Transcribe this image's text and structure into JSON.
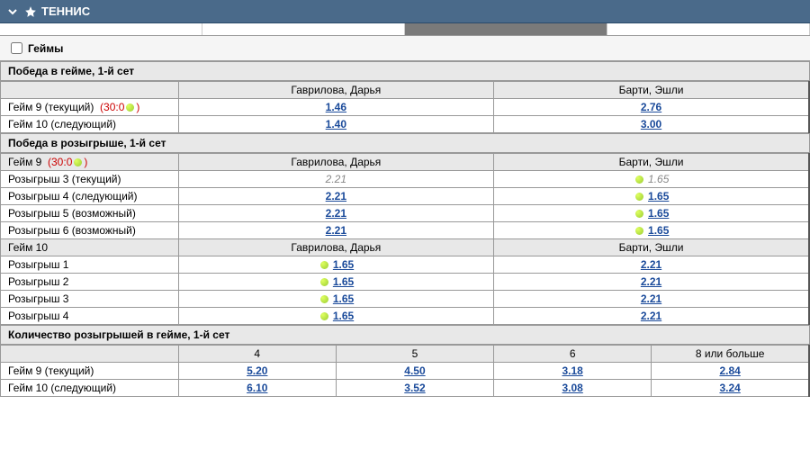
{
  "header": {
    "title": "ТЕННИС"
  },
  "category": {
    "label": "Геймы"
  },
  "market1": {
    "title": "Победа в гейме, 1-й сет",
    "players": [
      "Гаврилова, Дарья",
      "Барти, Эшли"
    ],
    "rows": [
      {
        "label": "Гейм 9  (текущий)",
        "score": "(30:0",
        "ball": true,
        "score_end": ")",
        "odds": [
          "1.46",
          "2.76"
        ]
      },
      {
        "label": "Гейм 10  (следующий)",
        "odds": [
          "1.40",
          "3.00"
        ]
      }
    ]
  },
  "market2": {
    "title": "Победа в розыгрыше, 1-й сет",
    "groups": [
      {
        "header_label": "Гейм 9",
        "header_score": "(30:0",
        "header_ball": true,
        "header_score_end": ")",
        "players": [
          "Гаврилова, Дарья",
          "Барти, Эшли"
        ],
        "rows": [
          {
            "label": "Розыгрыш 3  (текущий)",
            "odds": [
              {
                "v": "2.21",
                "locked": true,
                "ball": false
              },
              {
                "v": "1.65",
                "locked": true,
                "ball": true
              }
            ]
          },
          {
            "label": "Розыгрыш 4  (следующий)",
            "odds": [
              {
                "v": "2.21",
                "ball": false
              },
              {
                "v": "1.65",
                "ball": true
              }
            ]
          },
          {
            "label": "Розыгрыш 5  (возможный)",
            "odds": [
              {
                "v": "2.21",
                "ball": false
              },
              {
                "v": "1.65",
                "ball": true
              }
            ]
          },
          {
            "label": "Розыгрыш 6  (возможный)",
            "odds": [
              {
                "v": "2.21",
                "ball": false
              },
              {
                "v": "1.65",
                "ball": true
              }
            ]
          }
        ]
      },
      {
        "header_label": "Гейм 10",
        "players": [
          "Гаврилова, Дарья",
          "Барти, Эшли"
        ],
        "rows": [
          {
            "label": "Розыгрыш 1",
            "odds": [
              {
                "v": "1.65",
                "ball": true
              },
              {
                "v": "2.21",
                "ball": false
              }
            ]
          },
          {
            "label": "Розыгрыш 2",
            "odds": [
              {
                "v": "1.65",
                "ball": true
              },
              {
                "v": "2.21",
                "ball": false
              }
            ]
          },
          {
            "label": "Розыгрыш 3",
            "odds": [
              {
                "v": "1.65",
                "ball": true
              },
              {
                "v": "2.21",
                "ball": false
              }
            ]
          },
          {
            "label": "Розыгрыш 4",
            "odds": [
              {
                "v": "1.65",
                "ball": true
              },
              {
                "v": "2.21",
                "ball": false
              }
            ]
          }
        ]
      }
    ]
  },
  "market3": {
    "title": "Количество розыгрышей в гейме, 1-й сет",
    "cols": [
      "4",
      "5",
      "6",
      "8 или больше"
    ],
    "rows": [
      {
        "label": "Гейм 9 (текущий)",
        "odds": [
          "5.20",
          "4.50",
          "3.18",
          "2.84"
        ]
      },
      {
        "label": "Гейм 10 (следующий)",
        "odds": [
          "6.10",
          "3.52",
          "3.08",
          "3.24"
        ]
      }
    ]
  }
}
